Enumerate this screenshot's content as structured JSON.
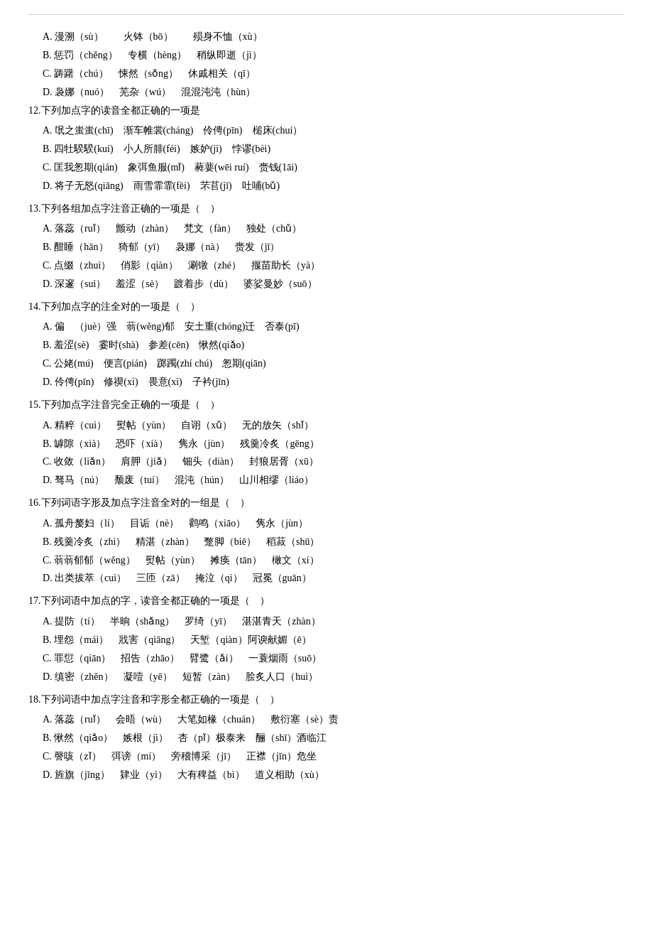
{
  "top_border": true,
  "questions": [
    {
      "id": "top_options",
      "options": [
        "A. 漫溯（sù）　　火钵（bō）　　殒身不恤（xù）",
        "B. 惩罚（chěng）　专横（hèng）　稍纵即逝（jì）",
        "C. 踌躇（chú）　悚然（sǒng）　休戚相关（qī）",
        "D. 袅娜（nuó）　芜杂（wú）　混混沌沌（hùn）"
      ]
    },
    {
      "id": "q12",
      "title": "12.下列加点字的读音全都正确的一项是",
      "options": [
        "A. 氓之蚩蚩(chī)　渐车帷裳(cháng)　伶俜(pīn)　槌床(chuí）",
        "B. 四牡騤騤(kuí)　小人所腓(féi)　嫉妒(jì)　悖谬(bèi)",
        "C. 匡我怱期(qián)　象弭鱼服(mǐ)　蕤葽(wēi ruí)　赍钱(1āi)",
        "D. 将子无怒(qiāng)　雨雪霏霏(fēi)　芣苢(jī)　吐哺(bǔ)"
      ]
    },
    {
      "id": "q13",
      "title": "13.下列各组加点字注音正确的一项是（　）",
      "options": [
        "A. 落蕊（ruǐ）　颤动（zhàn）　梵文（fàn）　独处（chǔ）",
        "B. 酣睡（hān）　猗郁（yī）　袅娜（nà）　赍发（jī）",
        "C. 点缀（zhuì）　俏影（qiàn）　涮镦（zhé）　揠苗助长（yà）",
        "D. 深邃（suì）　羞涩（sè）　踱着步（dù）　婆娑曼妙（suō）"
      ]
    },
    {
      "id": "q14",
      "title": "14.下列加点字的注全对的一项是（　）",
      "options": [
        "A. 偏　（juè）强　蓊(wěng)郁　安土重(chóng)迁　否泰(pī)",
        "B. 羞涩(sè)　霎时(shà)　参差(cēn)　愀然(qiǎo)",
        "C. 公姥(mú)　便言(pián)　踯躅(zhí chú)　怱期(qiān)",
        "D. 伶俜(pīn)　修禊(xì)　畏意(xì)　子衿(jīn)"
      ]
    },
    {
      "id": "q15",
      "title": "15.下列加点字注音完全正确的一项是（　）",
      "options": [
        "A. 精粹（cuì）　熨帖（yùn）　自诩（xǔ）　无的放矢（shǐ）",
        "B. 罅隙（xià）　恐吓（xià）　隽永（jùn）　残羹冷炙（gēng）",
        "C. 收敛（liǎn）　肩胛（jiǎ）　钿头（diàn）　封狼居胥（xū）",
        "D. 驽马（nú）　颓废（tuí）　混沌（hún）　山川相缪（liáo）"
      ]
    },
    {
      "id": "q16",
      "title": "16.下列词语字形及加点字注音全对的一组是（　）",
      "options": [
        "A. 孤舟嫠妇（lí）　目诟（nè）　鹳鸣（xiāo）　隽永（jùn）",
        "B. 残羹冷炙（zhì）　精湛（zhàn）　蹩脚（biē）　稻菽（shū）",
        "C. 蓊蓊郁郁（wěng）　熨帖（yùn）　摊痪（tān）　橄文（xí）",
        "D. 出类拔萃（cuì）　三匝（zā）　掩泣（qì）　冠冕（guān）"
      ]
    },
    {
      "id": "q17",
      "title": "17.下列词语中加点的字，读音全都正确的一项是（　）",
      "options": [
        "A. 提防（tí）　半晌（shǎng）　罗绮（yī）　湛湛青天（zhàn）",
        "B. 埋怨（mái）　戕害（qiāng）　天堑（qiàn）阿谀献媚（ē）",
        "C. 罪愆（qiān）　招告（zhāo）　臂鹭（ǎi）　一蓑烟雨（suō）",
        "D. 缜密（zhěn）　凝噎（yē）　短暂（zàn）　脍炙人口（huì）"
      ]
    },
    {
      "id": "q18",
      "title": "18.下列词语中加点字注音和字形全都正确的一项是（　）",
      "options": [
        "A. 落蕊（ruǐ）　会晤（wù）　大笔如椽（chuán）　敷衍塞（sè）责",
        "B. 愀然（qiǎo）　嫉根（jì）　杏（pǐ）极泰来　酾（shī）酒临江",
        "C. 謦咳（zǐ）　弭谤（mí）　旁稽博采（jī）　正襟（jīn）危坐",
        "D. 旌旗（jīng）　肄业（yì）　大有稗益（bì）　道义相助（xù）"
      ]
    }
  ]
}
